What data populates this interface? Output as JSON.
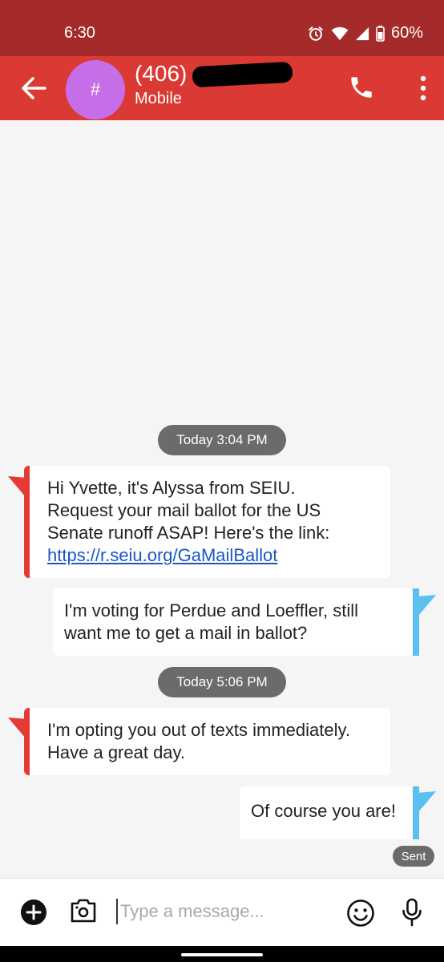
{
  "status_bar": {
    "time": "6:30",
    "battery": "60%",
    "icons": [
      "alarm-icon",
      "wifi-icon",
      "signal-icon",
      "battery-icon"
    ]
  },
  "header": {
    "contact_number": "(406)",
    "contact_type": "Mobile",
    "avatar_glyph": "#",
    "colors": {
      "app_bar": "#db3a34",
      "status_bar": "#a52a2a",
      "avatar": "#c66ee8"
    }
  },
  "conversation": {
    "date_dividers": [
      "Today 3:04 PM",
      "Today 5:06 PM"
    ],
    "messages": [
      {
        "direction": "incoming",
        "lines": [
          "Hi Yvette, it's Alyssa from SEIU.",
          "Request your mail ballot for the US",
          "Senate runoff ASAP! Here's the link:"
        ],
        "link": "https://r.seiu.org/GaMailBallot"
      },
      {
        "direction": "outgoing",
        "lines": [
          "I'm voting for Perdue and Loeffler, still",
          "want me to get a mail in ballot?"
        ]
      },
      {
        "direction": "incoming",
        "lines": [
          "I'm opting you out of texts immediately.",
          "Have a great day."
        ]
      },
      {
        "direction": "outgoing",
        "lines": [
          "Of course you are!"
        ],
        "status": "Sent"
      }
    ],
    "colors": {
      "incoming_accent": "#e53935",
      "outgoing_accent": "#5bc0f0",
      "pill": "#6b6b6b"
    }
  },
  "compose": {
    "placeholder": "Type a message..."
  }
}
